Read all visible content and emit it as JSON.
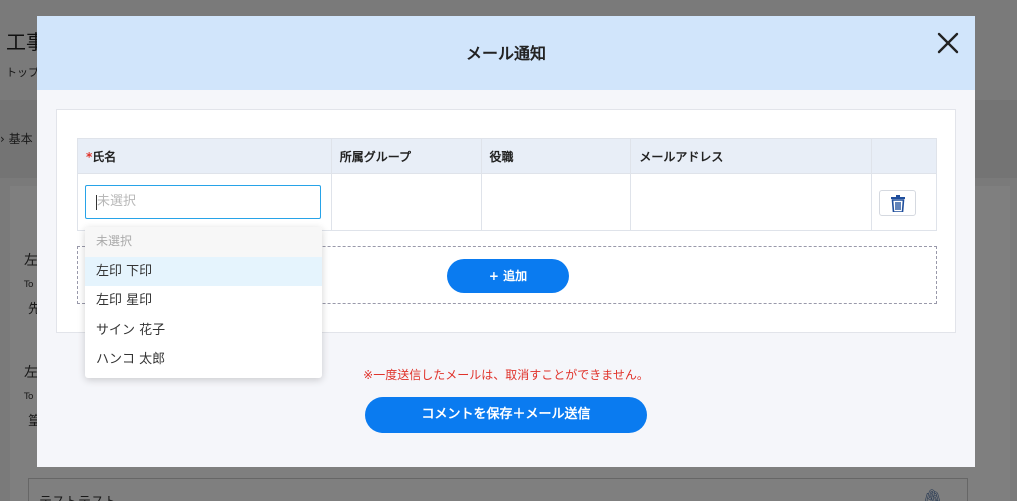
{
  "background": {
    "title": "工事",
    "breadcrumb": "トップ",
    "tab": "基本",
    "row1_label": "左",
    "row1_sub": "To",
    "row1_value": "先",
    "row2_label": "左",
    "row2_sub": "To",
    "row2_value": "篁",
    "bottom_text": "テストテスト"
  },
  "modal": {
    "title": "メール通知",
    "columns": {
      "name": "氏名",
      "name_required_mark": "*",
      "group": "所属グループ",
      "position": "役職",
      "email": "メールアドレス"
    },
    "name_input_placeholder": "未選択",
    "dropdown_options": [
      {
        "label": "未選択",
        "disabled": true
      },
      {
        "label": "左印 下印",
        "highlighted": true
      },
      {
        "label": "左印 星印"
      },
      {
        "label": "サイン 花子"
      },
      {
        "label": "ハンコ 太郎"
      }
    ],
    "add_button_label": "+ 追加",
    "warning_text": "※一度送信したメールは、取消すことができません。",
    "save_button_label": "コメントを保存＋メール送信"
  },
  "colors": {
    "accent": "#0a7bf0",
    "header_bg": "#d1e5fb",
    "warning": "#e0322a",
    "focus_border": "#27a3e8"
  },
  "icons": {
    "close": "close-icon",
    "delete": "trash-icon",
    "clip": "paperclip-icon"
  }
}
